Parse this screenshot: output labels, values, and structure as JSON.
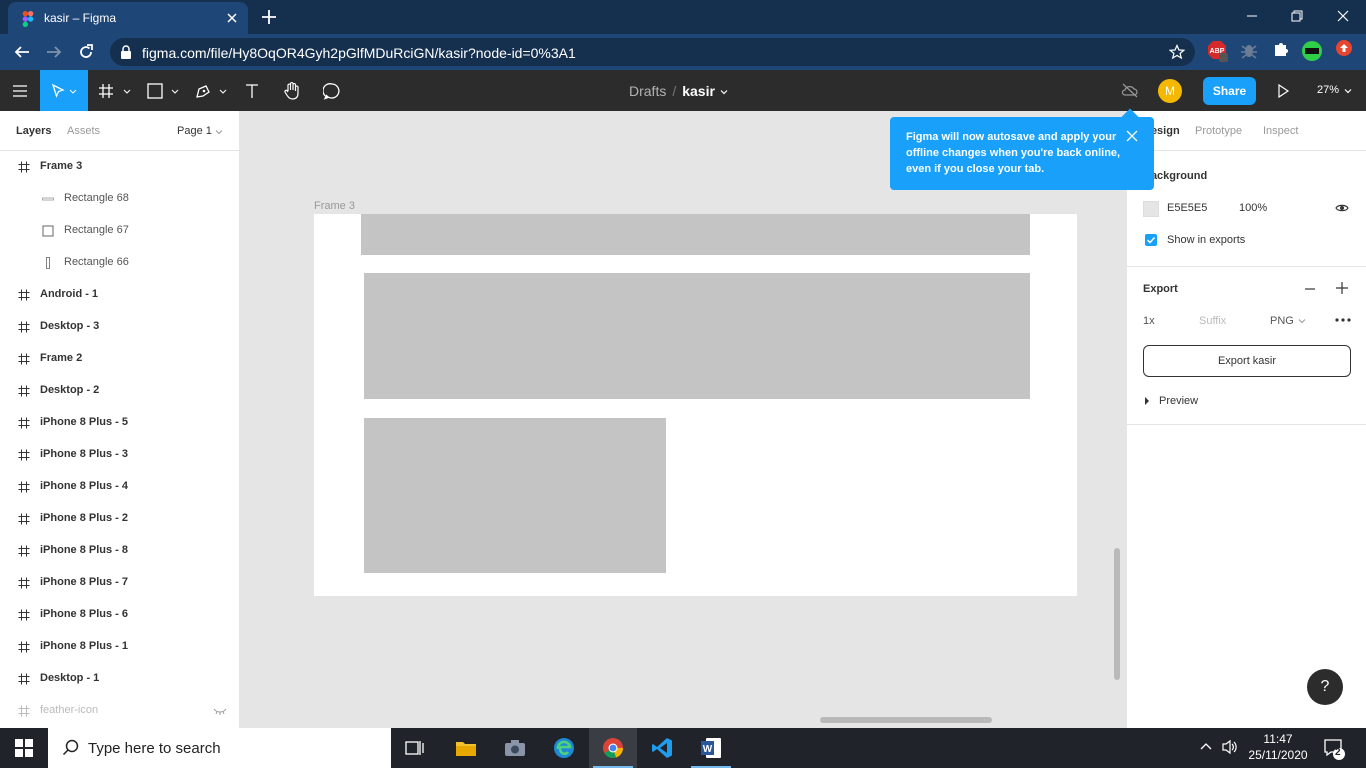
{
  "browser": {
    "tab_title": "kasir – Figma",
    "url": "figma.com/file/Hy8OqOR4Gyh2pGlfMDuRciGN/kasir?node-id=0%3A1",
    "ext_abp_badge": "1"
  },
  "toolbar": {
    "breadcrumb_project": "Drafts",
    "breadcrumb_separator": "/",
    "file_name": "kasir",
    "avatar_initial": "M",
    "share_label": "Share",
    "zoom": "27%"
  },
  "left_panel": {
    "tab_layers": "Layers",
    "tab_assets": "Assets",
    "page": "Page 1",
    "layers": [
      {
        "name": "Frame 3",
        "kind": "frame"
      },
      {
        "name": "Rectangle 68",
        "kind": "child-line"
      },
      {
        "name": "Rectangle 67",
        "kind": "child-rect"
      },
      {
        "name": "Rectangle 66",
        "kind": "child-thin"
      },
      {
        "name": "Android - 1",
        "kind": "frame"
      },
      {
        "name": "Desktop - 3",
        "kind": "frame"
      },
      {
        "name": "Frame 2",
        "kind": "frame"
      },
      {
        "name": "Desktop - 2",
        "kind": "frame"
      },
      {
        "name": "iPhone 8 Plus - 5",
        "kind": "frame"
      },
      {
        "name": "iPhone 8 Plus - 3",
        "kind": "frame"
      },
      {
        "name": "iPhone 8 Plus - 4",
        "kind": "frame"
      },
      {
        "name": "iPhone 8 Plus - 2",
        "kind": "frame"
      },
      {
        "name": "iPhone 8 Plus - 8",
        "kind": "frame"
      },
      {
        "name": "iPhone 8 Plus - 7",
        "kind": "frame"
      },
      {
        "name": "iPhone 8 Plus - 6",
        "kind": "frame"
      },
      {
        "name": "iPhone 8 Plus - 1",
        "kind": "frame"
      },
      {
        "name": "Desktop - 1",
        "kind": "frame"
      },
      {
        "name": "feather-icon",
        "kind": "hidden"
      }
    ]
  },
  "canvas": {
    "frame_label": "Frame 3"
  },
  "toast": {
    "message": "Figma will now autosave and apply your offline changes when you're back online, even if you close your tab."
  },
  "right_panel": {
    "tab_design": "Design",
    "tab_prototype": "Prototype",
    "tab_inspect": "Inspect",
    "background_title": "Background",
    "background_hex": "E5E5E5",
    "background_opacity": "100%",
    "show_in_exports": "Show in exports",
    "export_title": "Export",
    "export_scale": "1x",
    "export_suffix_placeholder": "Suffix",
    "export_format": "PNG",
    "export_button": "Export kasir",
    "preview_label": "Preview",
    "help": "?"
  },
  "taskbar": {
    "search_placeholder": "Type here to search",
    "time": "11:47",
    "date": "25/11/2020",
    "notifications": "2"
  },
  "colors": {
    "figma_blue": "#18a0fb",
    "toolbar_dark": "#2c2c2c",
    "canvas_bg": "#e5e5e5",
    "shape_gray": "#c4c4c4"
  }
}
